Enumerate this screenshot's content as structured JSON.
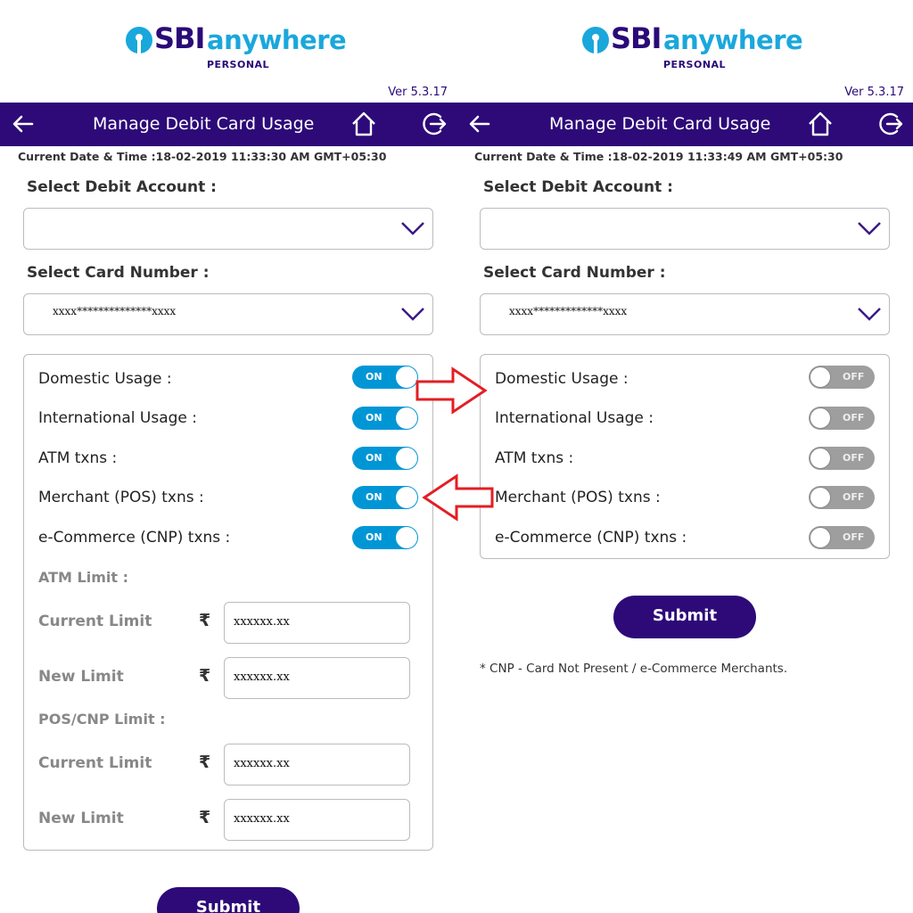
{
  "logo": {
    "brand": "SBI",
    "product": "anywhere",
    "edition": "PERSONAL"
  },
  "accent_colors": {
    "header": "#2d0a78",
    "toggle_on": "#0096d6",
    "toggle_off": "#9e9e9e",
    "annotation_arrow": "#e31e24"
  },
  "screens": [
    {
      "version": "Ver 5.3.17",
      "title": "Manage Debit Card Usage",
      "datetime": "Current Date & Time :18-02-2019 11:33:30 AM GMT+05:30",
      "debit_account_label": "Select Debit Account :",
      "debit_account_value": "",
      "card_number_label": "Select Card Number :",
      "card_number_value": "xxxx**************xxxx",
      "toggles": [
        {
          "label": "Domestic Usage :",
          "state": "ON"
        },
        {
          "label": "International Usage :",
          "state": "ON"
        },
        {
          "label": "ATM txns :",
          "state": "ON"
        },
        {
          "label": "Merchant (POS) txns :",
          "state": "ON"
        },
        {
          "label": "e-Commerce (CNP) txns :",
          "state": "ON"
        }
      ],
      "atm_limit_heading": "ATM Limit :",
      "pos_limit_heading": "POS/CNP Limit :",
      "current_limit_label": "Current Limit",
      "new_limit_label": "New Limit",
      "currency_symbol": "₹",
      "atm_current_limit": "xxxxxx.xx",
      "atm_new_limit": "xxxxxx.xx",
      "pos_current_limit": "xxxxxx.xx",
      "pos_new_limit": "xxxxxx.xx",
      "submit_label": "Submit"
    },
    {
      "version": "Ver 5.3.17",
      "title": "Manage Debit Card Usage",
      "datetime": "Current Date & Time :18-02-2019 11:33:49 AM GMT+05:30",
      "debit_account_label": "Select Debit Account :",
      "debit_account_value": "",
      "card_number_label": "Select Card Number :",
      "card_number_value": "xxxx*************xxxx",
      "toggles": [
        {
          "label": "Domestic Usage :",
          "state": "OFF"
        },
        {
          "label": "International Usage :",
          "state": "OFF"
        },
        {
          "label": "ATM txns :",
          "state": "OFF"
        },
        {
          "label": "Merchant (POS) txns :",
          "state": "OFF"
        },
        {
          "label": "e-Commerce (CNP) txns :",
          "state": "OFF"
        }
      ],
      "submit_label": "Submit",
      "footnote": "* CNP - Card Not Present / e-Commerce Merchants."
    }
  ]
}
